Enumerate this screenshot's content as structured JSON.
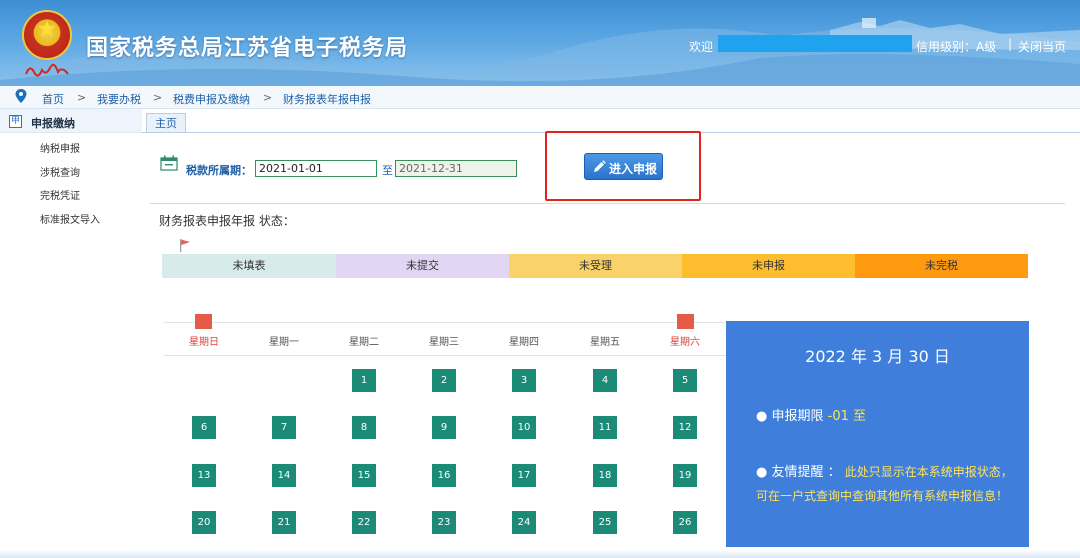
{
  "header": {
    "title": "国家税务总局江苏省电子税务局",
    "welcome": "欢迎",
    "credit_level": "信用级别：A级",
    "separator": "|",
    "close_page": "关闭当页",
    "brand_color": "#3d8fd3"
  },
  "breadcrumb": {
    "items": [
      "首页",
      "我要办税",
      "税费申报及缴纳",
      "财务报表年报申报"
    ],
    "separator": ">"
  },
  "sidebar": {
    "header": "申报缴纳",
    "header_icon_text": "申",
    "items": [
      "纳税申报",
      "涉税查询",
      "完税凭证",
      "标准报文导入"
    ]
  },
  "tab": {
    "label": "主页"
  },
  "period": {
    "label": "税款所属期：",
    "start": "2021-01-01",
    "to": "至",
    "end": "2021-12-31"
  },
  "enter_button": {
    "label": "进入申报",
    "icon": "pencil-icon"
  },
  "status": {
    "title": "财务报表申报年报 状态：",
    "segments": [
      {
        "label": "未填表",
        "color": "#d7ecea"
      },
      {
        "label": "未提交",
        "color": "#e2d6f4"
      },
      {
        "label": "未受理",
        "color": "#fad26a"
      },
      {
        "label": "未申报",
        "color": "#fdbd2f"
      },
      {
        "label": "未完税",
        "color": "#fd9a10"
      }
    ]
  },
  "calendar": {
    "weekdays": [
      "星期日",
      "星期一",
      "星期二",
      "星期三",
      "星期四",
      "星期五",
      "星期六"
    ],
    "days": [
      "1",
      "2",
      "3",
      "4",
      "5",
      "6",
      "7",
      "8",
      "9",
      "10",
      "11",
      "12",
      "13",
      "14",
      "15",
      "16",
      "17",
      "18",
      "19",
      "20",
      "21",
      "22",
      "23",
      "24",
      "25",
      "26"
    ],
    "day_color": "#1b8a76"
  },
  "info": {
    "date": "2022 年 3 月 30 日",
    "period_label": "● 申报期限",
    "period_value": "-01  至",
    "tip_label": "● 友情提醒 ：",
    "tip_line1": "此处只显示在本系统申报状态，",
    "tip_line2": "可在一户式查询中查询其他所有系统申报信息！",
    "bg_color": "#3f7fdb",
    "highlight_color": "#ffe35a"
  }
}
